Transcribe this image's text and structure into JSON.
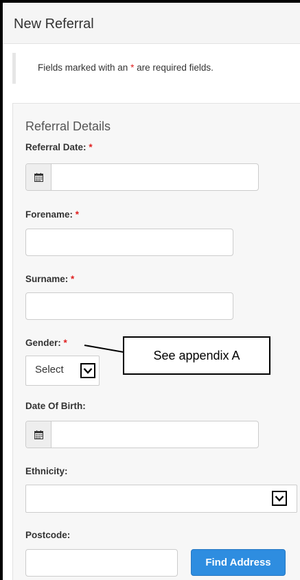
{
  "header": {
    "title": "New Referral"
  },
  "notice": {
    "prefix": "Fields marked with an ",
    "asterisk": "*",
    "suffix": " are required fields."
  },
  "section": {
    "title": "Referral Details"
  },
  "fields": {
    "referral_date": {
      "label": "Referral Date:",
      "required": "*",
      "value": ""
    },
    "forename": {
      "label": "Forename:",
      "required": "*",
      "value": ""
    },
    "surname": {
      "label": "Surname:",
      "required": "*",
      "value": ""
    },
    "gender": {
      "label": "Gender:",
      "required": "*",
      "selected": "Select"
    },
    "date_of_birth": {
      "label": "Date Of Birth:",
      "value": ""
    },
    "ethnicity": {
      "label": "Ethnicity:",
      "selected": ""
    },
    "postcode": {
      "label": "Postcode:",
      "value": ""
    }
  },
  "buttons": {
    "find_address": "Find Address"
  },
  "callout": {
    "text": "See appendix A"
  },
  "icons": {
    "calendar": "calendar-icon",
    "dropdown": "chevron-down-icon"
  },
  "colors": {
    "primary": "#2e8de0",
    "required": "#e02020",
    "panel_bg": "#f7f7f7"
  }
}
